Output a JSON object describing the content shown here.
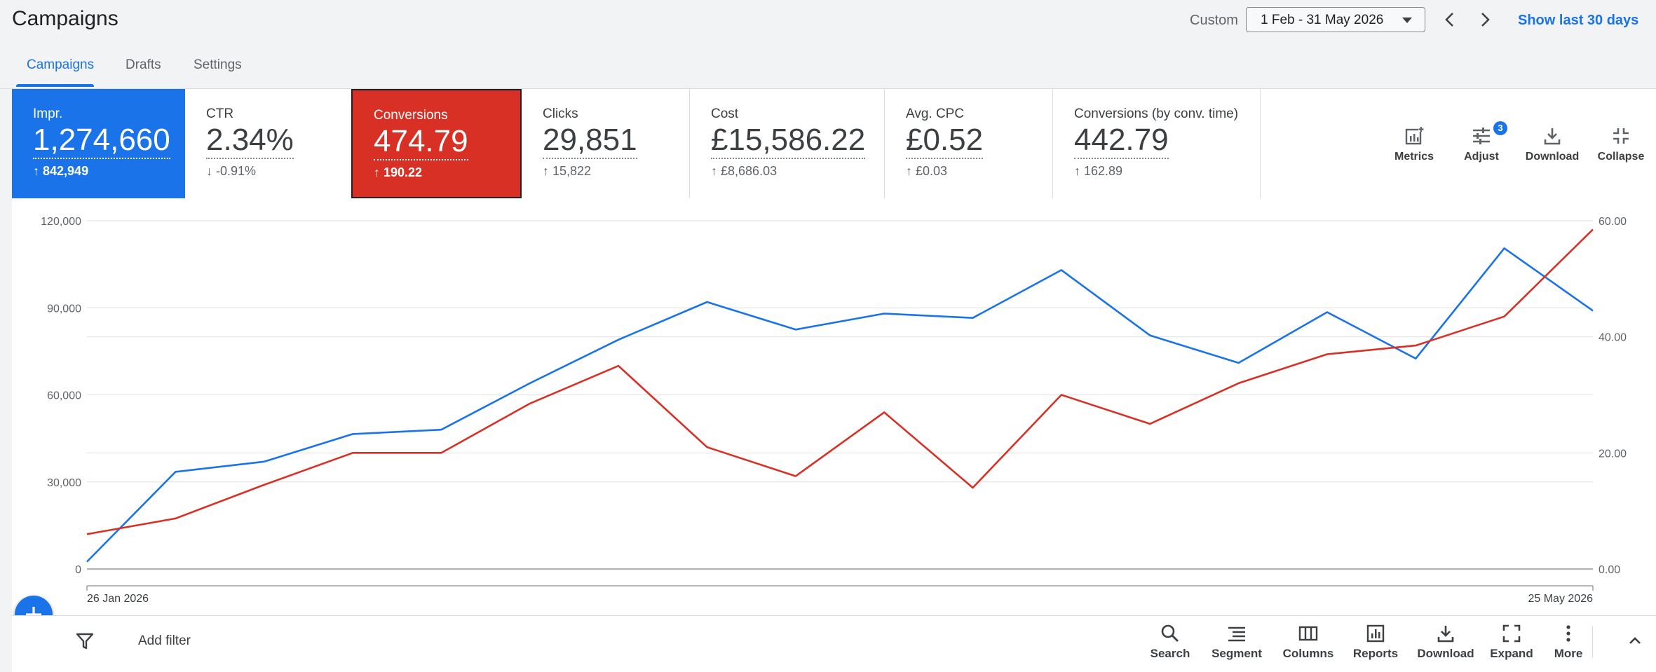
{
  "header": {
    "title": "Campaigns",
    "custom_label": "Custom",
    "date_range": "1 Feb - 31 May 2026",
    "show_last_30": "Show last 30 days"
  },
  "tabs": [
    {
      "label": "Campaigns",
      "active": true
    },
    {
      "label": "Drafts",
      "active": false
    },
    {
      "label": "Settings",
      "active": false
    }
  ],
  "metrics": [
    {
      "label": "Impr.",
      "value": "1,274,660",
      "delta": "842,949",
      "direction": "up",
      "selected_color": "#1a73e8"
    },
    {
      "label": "CTR",
      "value": "2.34%",
      "delta": "-0.91%",
      "direction": "down"
    },
    {
      "label": "Conversions",
      "value": "474.79",
      "delta": "190.22",
      "direction": "up",
      "selected_color": "#d93025"
    },
    {
      "label": "Clicks",
      "value": "29,851",
      "delta": "15,822",
      "direction": "up"
    },
    {
      "label": "Cost",
      "value": "£15,586.22",
      "delta": "£8,686.03",
      "direction": "up"
    },
    {
      "label": "Avg. CPC",
      "value": "£0.52",
      "delta": "£0.03",
      "direction": "up"
    },
    {
      "label": "Conversions (by conv. time)",
      "value": "442.79",
      "delta": "162.89",
      "direction": "up"
    }
  ],
  "metric_tools": [
    {
      "label": "Metrics",
      "icon": "metrics-icon"
    },
    {
      "label": "Adjust",
      "icon": "tune-icon",
      "badge": "3"
    },
    {
      "label": "Download",
      "icon": "download-icon"
    },
    {
      "label": "Collapse",
      "icon": "collapse-icon"
    }
  ],
  "chart_data": {
    "type": "line",
    "x_start_label": "26 Jan 2026",
    "x_end_label": "25 May 2026",
    "y_left": {
      "min": 0,
      "max": 120000,
      "ticks": [
        "0",
        "30,000",
        "60,000",
        "90,000",
        "120,000"
      ]
    },
    "y_right": {
      "min": 0,
      "max": 60,
      "ticks": [
        "0.00",
        "20.00",
        "40.00",
        "60.00"
      ]
    },
    "grid": true,
    "series": [
      {
        "axis": "left",
        "color": "#1a73e8",
        "values": [
          2500,
          33500,
          37000,
          46500,
          48000,
          64000,
          79000,
          92000,
          82500,
          88000,
          86500,
          103000,
          80500,
          71000,
          88500,
          72500,
          110500,
          89000
        ]
      },
      {
        "axis": "right",
        "color": "#d93025",
        "values": [
          6,
          8.7,
          14.5,
          20,
          20,
          28.5,
          35,
          21,
          16,
          27,
          14,
          30,
          25,
          32,
          37,
          38.5,
          43.5,
          58.5
        ]
      }
    ]
  },
  "filterbar": {
    "add_filter": "Add filter",
    "tools": [
      {
        "label": "Search",
        "icon": "search-icon"
      },
      {
        "label": "Segment",
        "icon": "segment-icon"
      },
      {
        "label": "Columns",
        "icon": "columns-icon"
      },
      {
        "label": "Reports",
        "icon": "reports-icon"
      },
      {
        "label": "Download",
        "icon": "download-icon"
      },
      {
        "label": "Expand",
        "icon": "expand-icon"
      },
      {
        "label": "More",
        "icon": "more-vert-icon"
      }
    ]
  }
}
